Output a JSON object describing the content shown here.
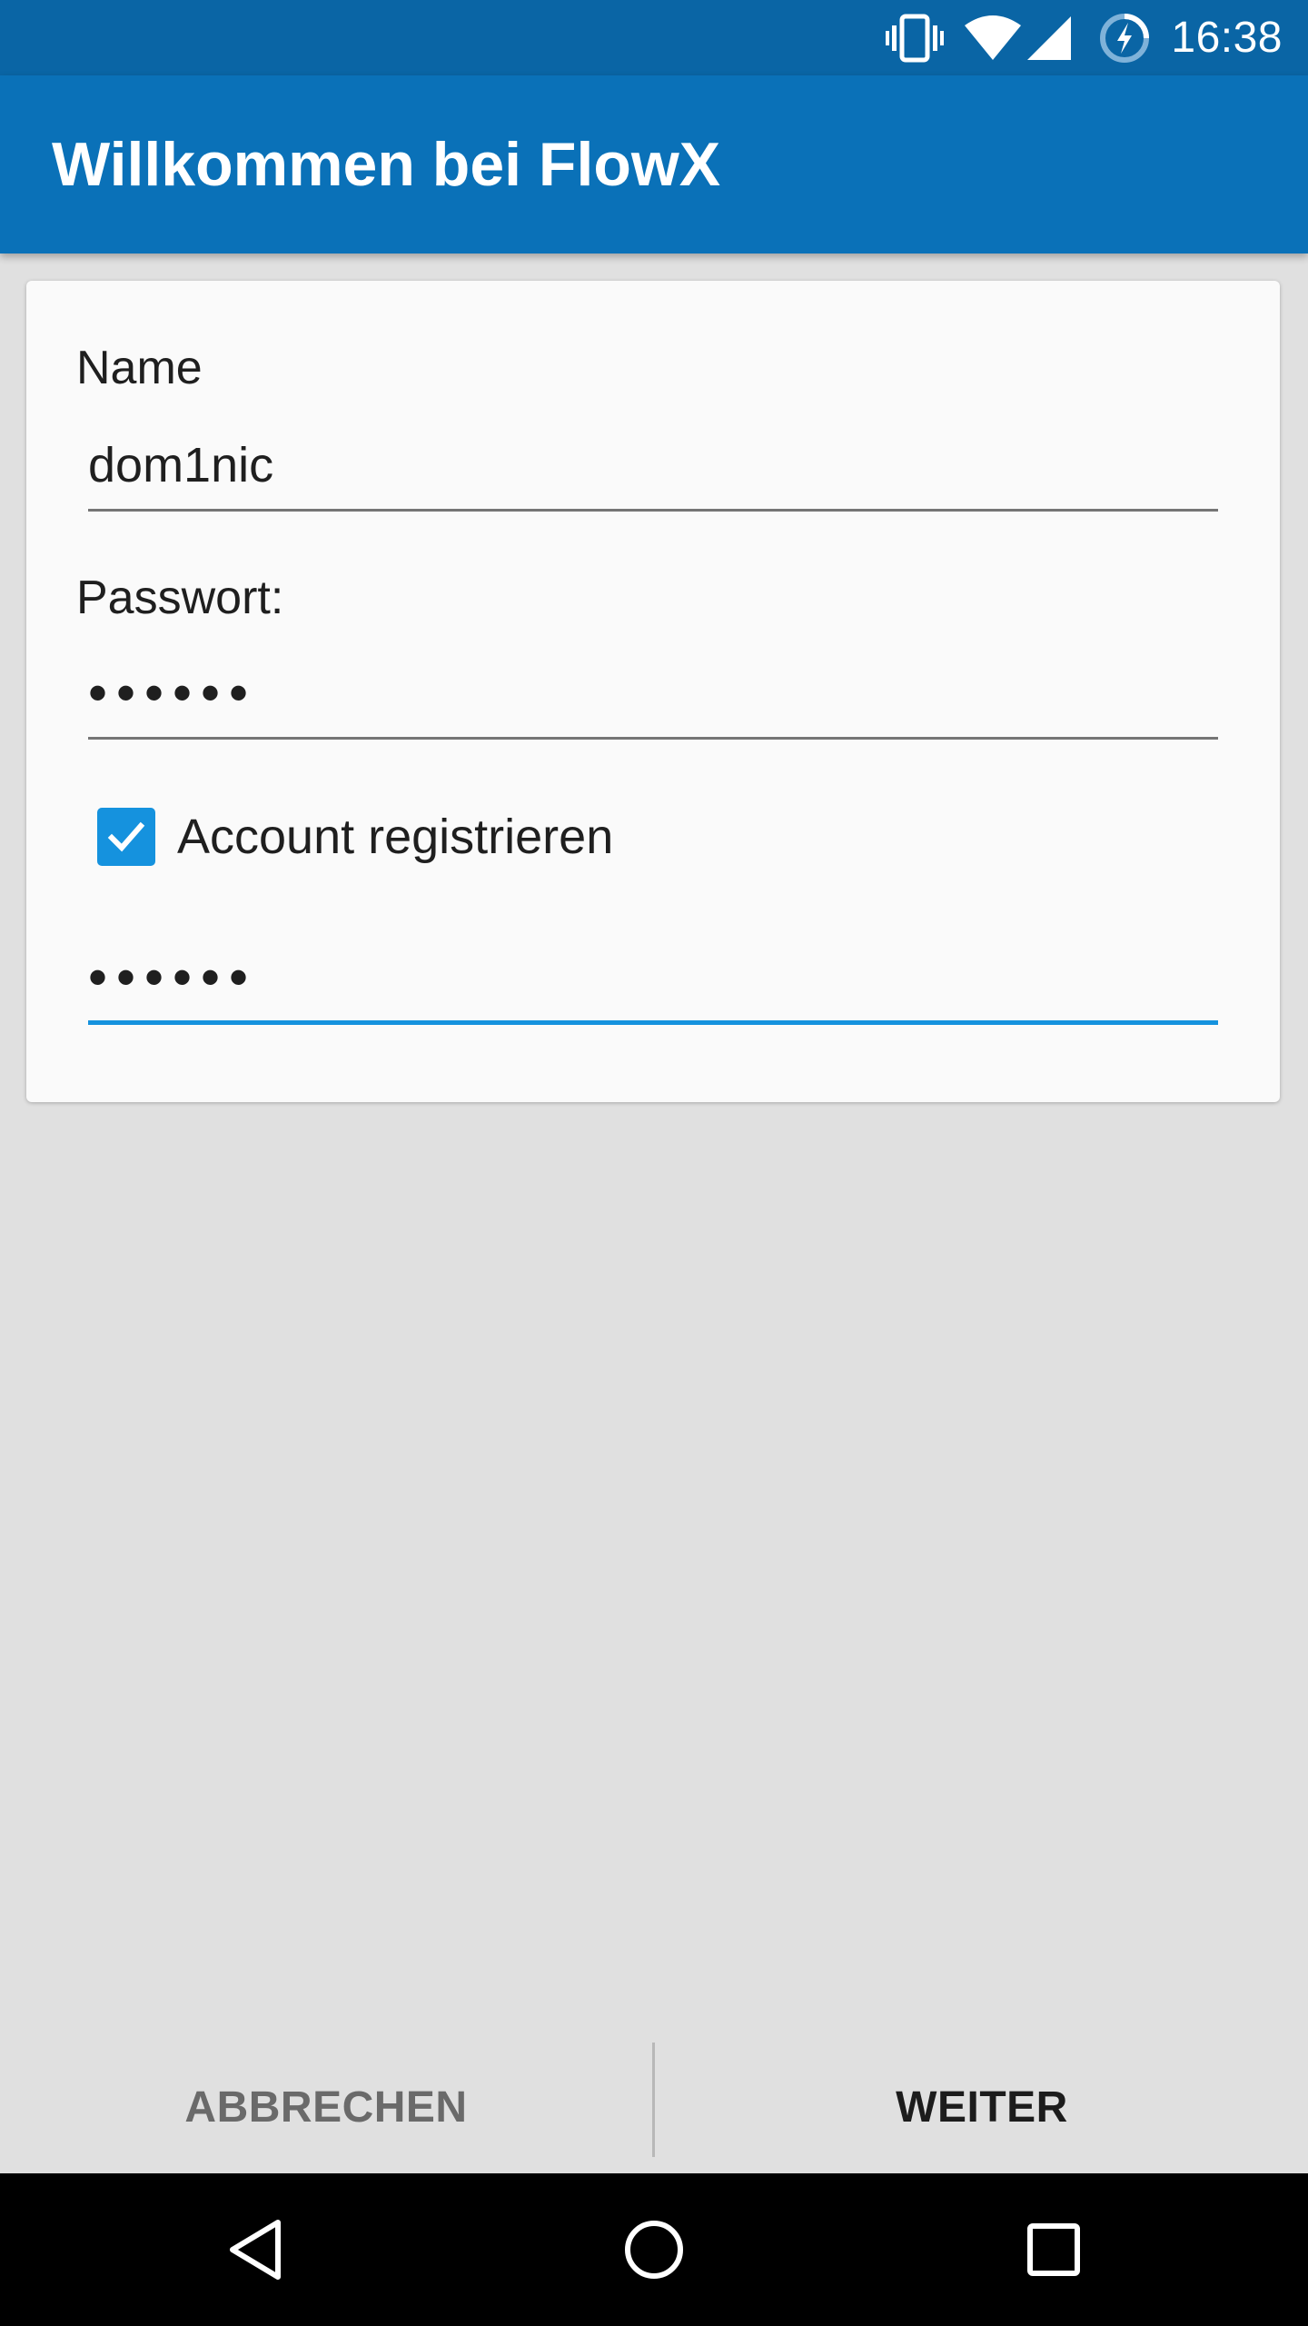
{
  "status_bar": {
    "time": "16:38",
    "icons": [
      "vibrate-icon",
      "wifi-icon",
      "cell-signal-icon",
      "battery-charging-icon"
    ]
  },
  "app_bar": {
    "title": "Willkommen bei FlowX"
  },
  "form": {
    "name_label": "Name",
    "name_value": "dom1nic",
    "password_label": "Passwort:",
    "password_value": "••••••",
    "register_checkbox": {
      "label": "Account registrieren",
      "checked": true
    },
    "confirm_password_value": "••••••"
  },
  "actions": {
    "cancel_label": "ABBRECHEN",
    "next_label": "WEITER"
  },
  "nav_bar": {
    "icons": [
      "back-icon",
      "home-icon",
      "recents-icon"
    ]
  },
  "colors": {
    "status_bar": "#0a65a5",
    "app_bar": "#0a71b8",
    "accent": "#1592de",
    "background": "#e0e0e0",
    "card": "#fafafa"
  }
}
